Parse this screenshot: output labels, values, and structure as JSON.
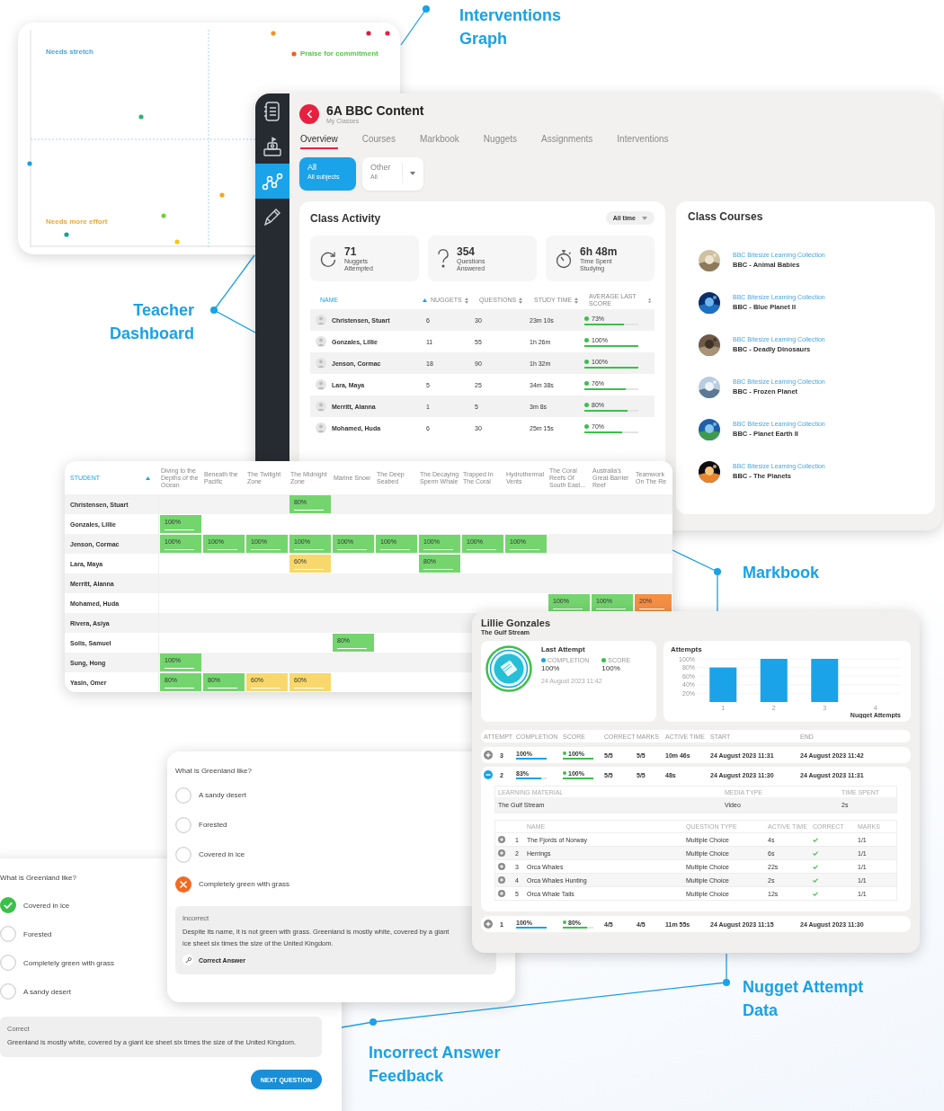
{
  "interventions_graph": {
    "quadrant_labels": [
      {
        "text": "Needs stretch",
        "color": "#4aa6e0"
      },
      {
        "text": "Praise for commitment",
        "color": "#57c34b"
      },
      {
        "text": "Needs more effort",
        "color": "#e8a93a"
      }
    ]
  },
  "dashboard": {
    "sidebar": [
      {
        "selected": false
      },
      {
        "selected": false
      },
      {
        "selected": true
      },
      {
        "selected": false
      }
    ],
    "title": "6A BBC Content",
    "breadcrumb": "My Classes",
    "tabs": [
      {
        "label": "Overview",
        "selected": true
      },
      {
        "label": "Courses",
        "selected": false
      },
      {
        "label": "Markbook",
        "selected": false
      },
      {
        "label": "Nuggets",
        "selected": false
      },
      {
        "label": "Assignments",
        "selected": false
      },
      {
        "label": "Interventions",
        "selected": false
      }
    ],
    "filters": [
      {
        "kind": "toggle",
        "label": "All",
        "sublabel": "All subjects",
        "selected": true
      },
      {
        "kind": "dropdown",
        "label": "Other",
        "sublabel": "All",
        "selected": false
      }
    ],
    "class_activity": {
      "title": "Class Activity",
      "period": "All time",
      "stats": [
        {
          "value": "71",
          "label": "Nuggets Attempted"
        },
        {
          "value": "354",
          "label": "Questions Answered"
        },
        {
          "value": "6h 48m",
          "label": "Time Spent Studying"
        }
      ],
      "columns": [
        {
          "label": "NAME",
          "sorted": true
        },
        {
          "label": "NUGGETS",
          "sorted": false
        },
        {
          "label": "QUESTIONS",
          "sorted": false
        },
        {
          "label": "STUDY TIME",
          "sorted": false
        },
        {
          "label": "AVERAGE LAST SCORE",
          "sorted": false
        }
      ],
      "rows": [
        {
          "name": "Christensen, Stuart",
          "nuggets": "6",
          "questions": "30",
          "study_time": "23m 10s",
          "score": {
            "text": "73%",
            "level": 0.73
          }
        },
        {
          "name": "Gonzales, Lillie",
          "nuggets": "11",
          "questions": "55",
          "study_time": "1h 26m",
          "score": {
            "text": "100%",
            "level": 1
          }
        },
        {
          "name": "Jenson, Cormac",
          "nuggets": "18",
          "questions": "90",
          "study_time": "1h 32m",
          "score": {
            "text": "100%",
            "level": 1
          }
        },
        {
          "name": "Lara, Maya",
          "nuggets": "5",
          "questions": "25",
          "study_time": "34m 38s",
          "score": {
            "text": "76%",
            "level": 0.76
          }
        },
        {
          "name": "Merritt, Alanna",
          "nuggets": "1",
          "questions": "5",
          "study_time": "3m 8s",
          "score": {
            "text": "80%",
            "level": 0.8
          }
        },
        {
          "name": "Mohamed, Huda",
          "nuggets": "6",
          "questions": "30",
          "study_time": "25m 15s",
          "score": {
            "text": "70%",
            "level": 0.7
          }
        }
      ]
    },
    "class_courses": {
      "title": "Class Courses",
      "items": [
        {
          "collection": "BBC Bitesize Learning Collection",
          "name": "BBC - Animal Babies"
        },
        {
          "collection": "BBC Bitesize Learning Collection",
          "name": "BBC - Blue Planet II"
        },
        {
          "collection": "BBC Bitesize Learning Collection",
          "name": "BBC - Deadly Dinosaurs"
        },
        {
          "collection": "BBC Bitesize Learning Collection",
          "name": "BBC - Frozen Planet"
        },
        {
          "collection": "BBC Bitesize Learning Collection",
          "name": "BBC - Planet Earth II"
        },
        {
          "collection": "BBC Bitesize Learning Collection",
          "name": "BBC - The Planets"
        }
      ]
    }
  },
  "markbook": {
    "student_column": {
      "label": "STUDENT",
      "sorted": true
    },
    "columns": [
      "Diving to the Depths of the Ocean",
      "Beneath the Pacific",
      "The Twilight Zone",
      "The Midnight Zone",
      "Marine Snow",
      "The Deep Seabed",
      "The Decaying Sperm Whale",
      "Trapped In The Coral",
      "Hydrothermal Vents",
      "The Coral Reefs Of South East...",
      "Australia's Great Barrier Reef",
      "Teamwork On The Re"
    ],
    "rows": [
      {
        "name": "Christensen, Stuart",
        "cells": [
          null,
          null,
          null,
          {
            "text": "80%",
            "color": "#74d56e"
          },
          null,
          null,
          null,
          null,
          null,
          null,
          null,
          null
        ]
      },
      {
        "name": "Gonzales, Lillie",
        "cells": [
          {
            "text": "100%",
            "color": "#74d56e"
          },
          null,
          null,
          null,
          null,
          null,
          null,
          null,
          null,
          null,
          null,
          null
        ]
      },
      {
        "name": "Jenson, Cormac",
        "cells": [
          {
            "text": "100%",
            "color": "#74d56e"
          },
          {
            "text": "100%",
            "color": "#74d56e"
          },
          {
            "text": "100%",
            "color": "#74d56e"
          },
          {
            "text": "100%",
            "color": "#74d56e"
          },
          {
            "text": "100%",
            "color": "#74d56e"
          },
          {
            "text": "100%",
            "color": "#74d56e"
          },
          {
            "text": "100%",
            "color": "#74d56e"
          },
          {
            "text": "100%",
            "color": "#74d56e"
          },
          {
            "text": "100%",
            "color": "#74d56e"
          },
          null,
          null,
          null
        ]
      },
      {
        "name": "Lara, Maya",
        "cells": [
          null,
          null,
          null,
          {
            "text": "60%",
            "color": "#f8d86c"
          },
          null,
          null,
          {
            "text": "80%",
            "color": "#74d56e"
          },
          null,
          null,
          null,
          null,
          null
        ]
      },
      {
        "name": "Merritt, Alanna",
        "cells": [
          null,
          null,
          null,
          null,
          null,
          null,
          null,
          null,
          null,
          null,
          null,
          null
        ]
      },
      {
        "name": "Mohamed, Huda",
        "cells": [
          null,
          null,
          null,
          null,
          null,
          null,
          null,
          null,
          null,
          {
            "text": "100%",
            "color": "#74d56e"
          },
          {
            "text": "100%",
            "color": "#74d56e"
          },
          {
            "text": "20%",
            "color": "#f58f45"
          }
        ]
      },
      {
        "name": "Rivera, Asiya",
        "cells": [
          null,
          null,
          null,
          null,
          null,
          null,
          null,
          null,
          null,
          null,
          null,
          null
        ]
      },
      {
        "name": "Solis, Samuel",
        "cells": [
          null,
          null,
          null,
          null,
          {
            "text": "80%",
            "color": "#74d56e"
          },
          null,
          null,
          null,
          null,
          null,
          null,
          null
        ]
      },
      {
        "name": "Sung, Hong",
        "cells": [
          {
            "text": "100%",
            "color": "#74d56e"
          },
          null,
          null,
          null,
          null,
          null,
          null,
          null,
          null,
          null,
          null,
          null
        ]
      },
      {
        "name": "Yasin, Omer",
        "cells": [
          {
            "text": "80%",
            "color": "#74d56e"
          },
          {
            "text": "80%",
            "color": "#74d56e"
          },
          {
            "text": "60%",
            "color": "#f8d86c"
          },
          {
            "text": "60%",
            "color": "#f8d86c"
          },
          null,
          null,
          null,
          null,
          null,
          null,
          null,
          null
        ]
      }
    ]
  },
  "attempt_details": {
    "student": "Lillie Gonzales",
    "nugget": "The Gulf Stream",
    "last_attempt": {
      "title": "Last Attempt",
      "metrics": [
        {
          "label": "COMPLETION",
          "value": "100%",
          "color": "#1aa3e8"
        },
        {
          "label": "SCORE",
          "value": "100%",
          "color": "#3cc04a"
        }
      ],
      "date": "24 August 2023 11:42"
    },
    "attempts_chart": {
      "chart_data": {
        "type": "bar",
        "title": "Attempts",
        "xlabel": "Nugget Attempts",
        "categories": [
          "1",
          "2",
          "3",
          "4"
        ],
        "values": [
          80,
          100,
          100,
          null
        ],
        "ylim": [
          0,
          100
        ],
        "grid": true,
        "yticks": [
          {
            "value": 20,
            "label": "20%"
          },
          {
            "value": 40,
            "label": "40%"
          },
          {
            "value": 60,
            "label": "60%"
          },
          {
            "value": 80,
            "label": "80%"
          },
          {
            "value": 100,
            "label": "100%"
          }
        ]
      }
    },
    "columns": [
      "ATTEMPT",
      "COMPLETION",
      "SCORE",
      "CORRECT",
      "MARKS",
      "ACTIVE TIME",
      "START",
      "END"
    ],
    "attempts": [
      {
        "attempt": "3",
        "expanded": false,
        "completion": {
          "text": "100%",
          "level": 1
        },
        "score": {
          "text": "100%",
          "level": 1
        },
        "correct": "5/5",
        "marks": "5/5",
        "active_time": "10m 46s",
        "start": "24 August 2023 11:31",
        "end": "24 August 2023 11:42"
      },
      {
        "attempt": "2",
        "expanded": true,
        "completion": {
          "text": "83%",
          "level": 0.83
        },
        "score": {
          "text": "100%",
          "level": 1
        },
        "correct": "5/5",
        "marks": "5/5",
        "active_time": "48s",
        "start": "24 August 2023 11:30",
        "end": "24 August 2023 11:31",
        "details": {
          "material_columns": [
            "LEARNING MATERIAL",
            "MEDIA TYPE",
            "TIME SPENT"
          ],
          "materials": [
            {
              "name": "The Gulf Stream",
              "media_type": "Video",
              "time_spent": "2s"
            }
          ],
          "question_columns": [
            "NAME",
            "QUESTION TYPE",
            "ACTIVE TIME",
            "CORRECT",
            "MARKS"
          ],
          "questions": [
            {
              "expanded": false,
              "number": "1",
              "name": "The Fjords of Norway",
              "type": "Multiple Choice",
              "active_time": "4s",
              "correct": true,
              "marks": "1/1"
            },
            {
              "expanded": false,
              "number": "2",
              "name": "Herrings",
              "type": "Multiple Choice",
              "active_time": "6s",
              "correct": true,
              "marks": "1/1"
            },
            {
              "expanded": false,
              "number": "3",
              "name": "Orca Whales",
              "type": "Multiple Choice",
              "active_time": "22s",
              "correct": true,
              "marks": "1/1"
            },
            {
              "expanded": false,
              "number": "4",
              "name": "Orca Whales Hunting",
              "type": "Multiple Choice",
              "active_time": "2s",
              "correct": true,
              "marks": "1/1"
            },
            {
              "expanded": false,
              "number": "5",
              "name": "Orca Whale Tails",
              "type": "Multiple Choice",
              "active_time": "12s",
              "correct": true,
              "marks": "1/1"
            }
          ]
        }
      },
      {
        "attempt": "1",
        "expanded": false,
        "completion": {
          "text": "100%",
          "level": 1
        },
        "score": {
          "text": "80%",
          "level": 0.8
        },
        "correct": "4/5",
        "marks": "4/5",
        "active_time": "11m 55s",
        "start": "24 August 2023 11:15",
        "end": "24 August 2023 11:30"
      }
    ]
  },
  "quiz_cards": [
    {
      "question": "What is Greenland like?",
      "answer_correct": false,
      "options": [
        {
          "label": "A sandy desert",
          "selected": false
        },
        {
          "label": "Forested",
          "selected": false
        },
        {
          "label": "Covered in ice",
          "selected": false
        },
        {
          "label": "Completely green with grass",
          "selected": true
        }
      ],
      "feedback": {
        "title": "Incorrect",
        "text": "Despite its name, it is not green with grass. Greenland is mostly white, covered by a giant ice sheet six times the size of the United Kingdom.",
        "action": "Correct Answer"
      }
    },
    {
      "question": "What is Greenland like?",
      "answer_correct": true,
      "options": [
        {
          "label": "Covered in ice",
          "selected": true
        },
        {
          "label": "Forested",
          "selected": false
        },
        {
          "label": "Completely green with grass",
          "selected": false
        },
        {
          "label": "A sandy desert",
          "selected": false
        }
      ],
      "feedback": {
        "title": "Correct",
        "text": "Greenland is mostly white, covered by a giant ice sheet six times the size of the United Kingdom."
      },
      "next_button": "NEXT QUESTION"
    }
  ],
  "callouts": [
    "Interventions Graph",
    "Teacher Dashboard",
    "Markbook",
    "Nugget Attempt Data",
    "Incorrect Answer Feedback"
  ]
}
